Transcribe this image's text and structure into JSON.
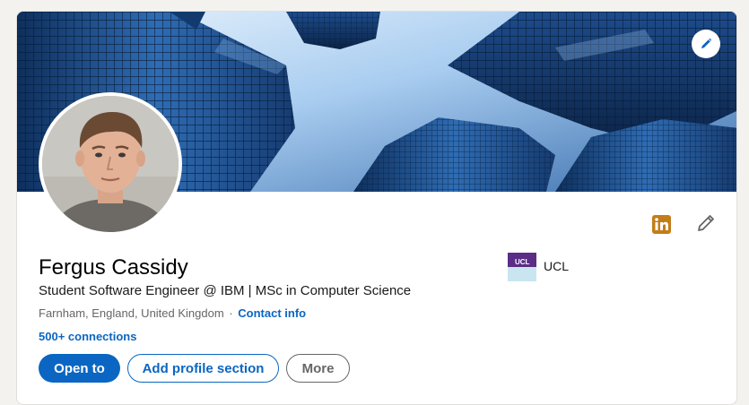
{
  "profile": {
    "name": "Fergus Cassidy",
    "headline": "Student Software Engineer @ IBM | MSc in Computer Science",
    "location": "Farnham, England, United Kingdom",
    "separator": "·",
    "contact_info_label": "Contact info",
    "connections_label": "500+ connections"
  },
  "education": {
    "school": "UCL",
    "logo_text": "UCL"
  },
  "actions": {
    "open_to": "Open to",
    "add_section": "Add profile section",
    "more": "More"
  },
  "icons": {
    "edit_cover": "pencil-icon",
    "linkedin_badge": "linkedin-icon",
    "edit_intro": "pencil-icon"
  },
  "colors": {
    "primary": "#0a66c2",
    "linkedin_badge": "#c37d16",
    "ucl_purple": "#5b2d86",
    "page_bg": "#f3f2ef"
  }
}
